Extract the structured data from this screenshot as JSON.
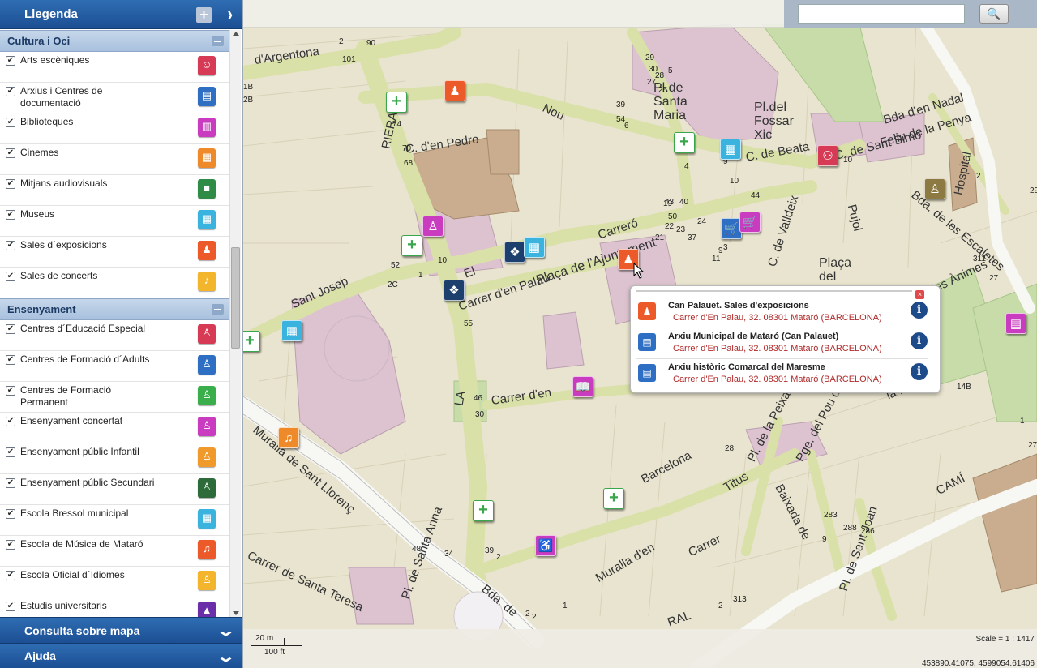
{
  "legend": {
    "title": "Llegenda",
    "groups": [
      {
        "name": "Cultura i Oci",
        "items": [
          {
            "label": "Arts escèniques",
            "icon": "theater-masks-icon",
            "color": "#d63a55"
          },
          {
            "label": "Arxius i Centres de documentació",
            "icon": "archive-doc-icon",
            "color": "#2e6fc4"
          },
          {
            "label": "Biblioteques",
            "icon": "book-icon",
            "color": "#c93cc0"
          },
          {
            "label": "Cinemes",
            "icon": "cinema-icon",
            "color": "#ef8a2a"
          },
          {
            "label": "Mitjans audiovisuals",
            "icon": "video-camera-icon",
            "color": "#2f8c46"
          },
          {
            "label": "Museus",
            "icon": "museum-icon",
            "color": "#3ab3de"
          },
          {
            "label": "Sales d´exposicions",
            "icon": "exhibition-icon",
            "color": "#ec5a2a"
          },
          {
            "label": "Sales de concerts",
            "icon": "concert-icon",
            "color": "#f2b52b"
          }
        ]
      },
      {
        "name": "Ensenyament",
        "items": [
          {
            "label": "Centres d´Educació Especial",
            "icon": "special-education-icon",
            "color": "#d63a55"
          },
          {
            "label": "Centres de Formació d´Adults",
            "icon": "adult-education-icon",
            "color": "#2e6fc4"
          },
          {
            "label": "Centres de Formació Permanent",
            "icon": "permanent-education-icon",
            "color": "#3aae4a"
          },
          {
            "label": "Ensenyament concertat",
            "icon": "concerted-school-icon",
            "color": "#c93cc0"
          },
          {
            "label": "Ensenyament públic Infantil",
            "icon": "public-infant-school-icon",
            "color": "#ef9a2a"
          },
          {
            "label": "Ensenyament públic Secundari",
            "icon": "public-secondary-school-icon",
            "color": "#2d6b3b"
          },
          {
            "label": "Escola Bressol municipal",
            "icon": "nursery-school-icon",
            "color": "#3ab3de"
          },
          {
            "label": "Escola de Música de Mataró",
            "icon": "music-school-icon",
            "color": "#ec5a2a"
          },
          {
            "label": "Escola Oficial d´Idiomes",
            "icon": "language-school-icon",
            "color": "#f2b52b"
          },
          {
            "label": "Estudis universitaris",
            "icon": "university-icon",
            "color": "#6a2fa8"
          }
        ]
      }
    ]
  },
  "panels": {
    "consulta": "Consulta sobre mapa",
    "ajuda": "Ajuda"
  },
  "search": {
    "placeholder": "",
    "button_icon": "🔍"
  },
  "map": {
    "scale_metric": "20 m",
    "scale_imperial": "100 ft",
    "scale_ratio": "Scale = 1 : 1417",
    "coordinates": "453890.41075, 4599054.61406",
    "streets": [
      {
        "text": "d'Argentona"
      },
      {
        "text": "Nou"
      },
      {
        "text": "Pl.de Santa Maria"
      },
      {
        "text": "Pl.del Fossar Xic"
      },
      {
        "text": "RIERA"
      },
      {
        "text": "C. d'en Pedro"
      },
      {
        "text": "Plaça de l'Ajuntament"
      },
      {
        "text": "Carreró"
      },
      {
        "text": "Carrer d'en Palau"
      },
      {
        "text": "El"
      },
      {
        "text": "Sant Josep"
      },
      {
        "text": "LA"
      },
      {
        "text": "Carrer d'en"
      },
      {
        "text": "Muralla de Sant Llorenç"
      },
      {
        "text": "Carrer de Santa Teresa"
      },
      {
        "text": "Pl. de Santa Anna"
      },
      {
        "text": "Bda. de"
      },
      {
        "text": "Barcelona"
      },
      {
        "text": "Titus"
      },
      {
        "text": "Muralla d'en"
      },
      {
        "text": "Pl. de la Peixateria"
      },
      {
        "text": "Pge. del Pou d'Avall"
      },
      {
        "text": "Baixada de"
      },
      {
        "text": "Pl. de Sant Joan"
      },
      {
        "text": "CAMÍ"
      },
      {
        "text": "RAL"
      },
      {
        "text": "Plaça del Beat"
      },
      {
        "text": "C. de Valldeix"
      },
      {
        "text": "C. de Beata"
      },
      {
        "text": "C. de Sant Simó"
      },
      {
        "text": "Bda d'en Nadal"
      },
      {
        "text": "Feliu de la Penya"
      },
      {
        "text": "Hospital"
      },
      {
        "text": "Bda. de les Escaletes"
      },
      {
        "text": "de les Ànimes"
      },
      {
        "text": "la Muralla"
      },
      {
        "text": "Pujol"
      },
      {
        "text": "Carrer"
      }
    ],
    "numbers": [
      "2",
      "90",
      "101",
      "1B",
      "2B",
      "74",
      "70",
      "68",
      "39",
      "54",
      "6",
      "29",
      "30",
      "27",
      "28",
      "25",
      "5",
      "24",
      "11",
      "22",
      "23",
      "19",
      "43",
      "50",
      "40",
      "10",
      "21",
      "37",
      "44",
      "3",
      "9",
      "10",
      "52",
      "2C",
      "1",
      "55",
      "46",
      "30",
      "28",
      "48",
      "34",
      "39",
      "2",
      "1",
      "2",
      "2",
      "9",
      "288",
      "286",
      "283",
      "2",
      "313",
      "311",
      "14B",
      "27",
      "1",
      "27",
      "29",
      "2T",
      "10",
      "9",
      "4"
    ],
    "pois": [
      {
        "type": "health-cross-icon",
        "color": "#39a64c"
      },
      {
        "type": "exhibition-icon",
        "color": "#ec5a2a"
      },
      {
        "type": "health-cross-icon",
        "color": "#39a64c"
      },
      {
        "type": "museum-icon",
        "color": "#3ab3de"
      },
      {
        "type": "special-education-icon",
        "color": "#d63a55"
      },
      {
        "type": "public-infant-school-icon",
        "color": "#b89a4a"
      },
      {
        "type": "concerted-school-icon",
        "color": "#c93cc0"
      },
      {
        "type": "health-cross-icon",
        "color": "#39a64c"
      },
      {
        "type": "government-icon",
        "color": "#1d3f6e"
      },
      {
        "type": "museum-icon",
        "color": "#3ab3de"
      },
      {
        "type": "market-icon",
        "color": "#2e6fc4"
      },
      {
        "type": "market-icon",
        "color": "#c93cc0"
      },
      {
        "type": "exhibition-icon",
        "color": "#ec5a2a"
      },
      {
        "type": "government-icon",
        "color": "#1d3f6e"
      },
      {
        "type": "museum-icon",
        "color": "#3ab3de"
      },
      {
        "type": "health-cross-icon",
        "color": "#39a64c"
      },
      {
        "type": "book-icon",
        "color": "#c93cc0"
      },
      {
        "type": "music-school-icon",
        "color": "#ef8a2a"
      },
      {
        "type": "health-cross-icon",
        "color": "#39a64c"
      },
      {
        "type": "health-cross-icon",
        "color": "#39a64c"
      },
      {
        "type": "accessibility-icon",
        "color": "#c93cc0"
      },
      {
        "type": "theater-masks-icon",
        "color": "#c93cc0"
      }
    ]
  },
  "popup": {
    "rows": [
      {
        "name": "Can Palauet. Sales d'exposicions",
        "address": "Carrer d'En Palau, 32. 08301 Mataró (BARCELONA)",
        "icon": "exhibition-icon",
        "color": "#ec5a2a"
      },
      {
        "name": "Arxiu Municipal de Mataró (Can Palauet)",
        "address": "Carrer d'En Palau, 32. 08301 Mataró (BARCELONA)",
        "icon": "archive-doc-icon",
        "color": "#2e6fc4"
      },
      {
        "name": "Arxiu històric Comarcal del Maresme",
        "address": "Carrer d'En Palau, 32. 08301 Mataró (BARCELONA)",
        "icon": "archive-doc-icon",
        "color": "#2e6fc4"
      }
    ]
  }
}
